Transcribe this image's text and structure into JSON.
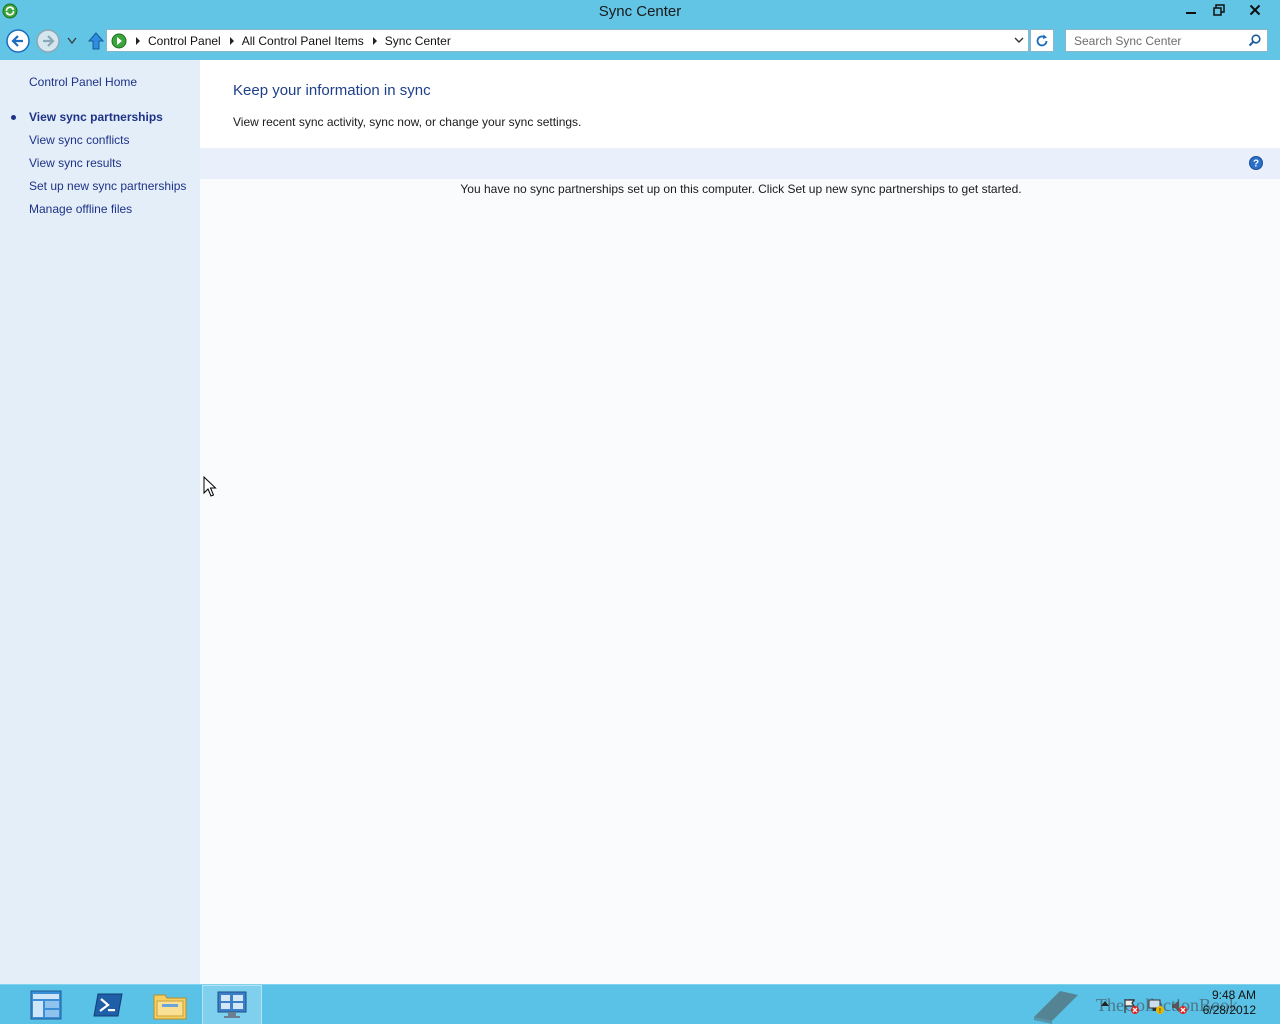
{
  "window": {
    "title": "Sync Center",
    "controls": {
      "minimize_icon": "minimize-icon",
      "restore_icon": "restore-icon",
      "close_icon": "close-icon"
    }
  },
  "address_bar": {
    "breadcrumbs": [
      "Control Panel",
      "All Control Panel Items",
      "Sync Center"
    ],
    "search_placeholder": "Search Sync Center"
  },
  "left_pane": {
    "home_link": "Control Panel Home",
    "tasks": [
      {
        "label": "View sync partnerships",
        "active": true
      },
      {
        "label": "View sync conflicts",
        "active": false
      },
      {
        "label": "View sync results",
        "active": false
      },
      {
        "label": "Set up new sync partnerships",
        "active": false
      },
      {
        "label": "Manage offline files",
        "active": false
      }
    ]
  },
  "main": {
    "heading": "Keep your information in sync",
    "subtitle": "View recent sync activity, sync now, or change your sync settings.",
    "empty_message": "You have no sync partnerships set up on this computer. Click Set up new sync partnerships to get started."
  },
  "taskbar": {
    "items": [
      "server-manager-icon",
      "powershell-icon",
      "file-explorer-icon",
      "control-panel-icon"
    ],
    "watermark": "TheCollectionBook",
    "clock_time": "9:48 AM",
    "clock_date": "6/28/2012"
  },
  "colors": {
    "titlebar": "#62c5e6",
    "link": "#1e3287",
    "heading": "#1e3f8b",
    "left_pane": "#e4eef9",
    "band": "#e9f0fc"
  }
}
